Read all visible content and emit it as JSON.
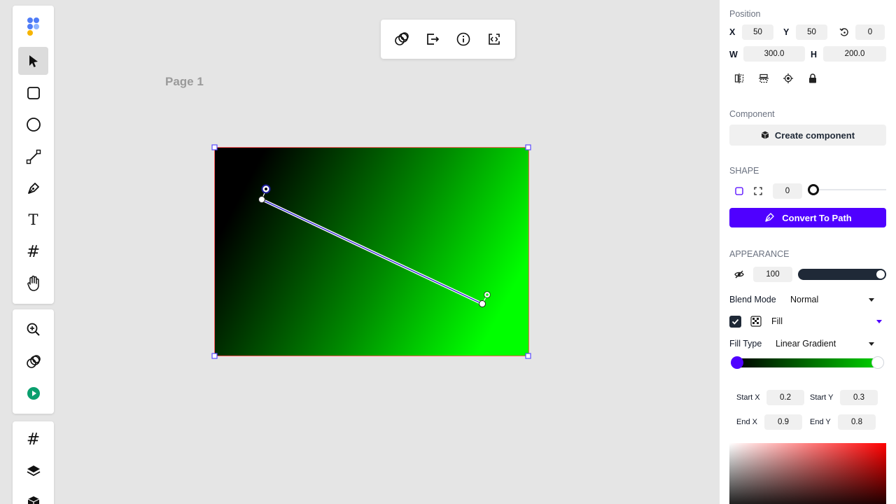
{
  "canvas": {
    "page_label": "Page 1"
  },
  "left_toolbar": {
    "tools": [
      {
        "name": "logo",
        "icon": "logo-icon"
      },
      {
        "name": "select",
        "icon": "cursor-icon",
        "active": true
      },
      {
        "name": "rectangle",
        "icon": "rectangle-icon"
      },
      {
        "name": "ellipse",
        "icon": "ellipse-icon"
      },
      {
        "name": "line",
        "icon": "line-icon"
      },
      {
        "name": "pen",
        "icon": "pen-icon"
      },
      {
        "name": "text",
        "icon": "text-icon",
        "glyph": "T"
      },
      {
        "name": "frame",
        "icon": "frame-icon",
        "glyph": "#"
      },
      {
        "name": "hand",
        "icon": "hand-icon"
      }
    ],
    "secondary": [
      {
        "name": "zoom",
        "icon": "zoom-in-icon"
      },
      {
        "name": "boolean",
        "icon": "boolean-icon"
      },
      {
        "name": "play",
        "icon": "play-icon"
      }
    ],
    "tertiary": [
      {
        "name": "frames",
        "icon": "frame-icon",
        "glyph": "#"
      },
      {
        "name": "layers",
        "icon": "layers-icon"
      },
      {
        "name": "components",
        "icon": "component-icon"
      }
    ]
  },
  "floating_toolbar": {
    "buttons": [
      "boolean-icon",
      "export-icon",
      "info-icon",
      "code-icon"
    ]
  },
  "panel": {
    "position": {
      "title": "Position",
      "x_label": "X",
      "x_value": "50",
      "y_label": "Y",
      "y_value": "50",
      "rotation_value": "0",
      "w_label": "W",
      "w_value": "300.0",
      "h_label": "H",
      "h_value": "200.0"
    },
    "component": {
      "title": "Component",
      "create_label": "Create component"
    },
    "shape": {
      "title": "SHAPE",
      "radius_value": "0",
      "radius_slider_fraction": 0,
      "convert_label": "Convert To Path"
    },
    "appearance": {
      "title": "APPEARANCE",
      "opacity_value": "100",
      "opacity_slider_fraction": 1.0,
      "blend_label": "Blend Mode",
      "blend_value": "Normal",
      "fill_label": "Fill",
      "fill_type_label": "Fill Type",
      "fill_type_value": "Linear Gradient",
      "gradient_start_color": "#000000",
      "gradient_end_color": "#00ff00",
      "start_x_label": "Start X",
      "start_x_value": "0.2",
      "start_y_label": "Start Y",
      "start_y_value": "0.3",
      "end_x_label": "End X",
      "end_x_value": "0.9",
      "end_y_label": "End Y",
      "end_y_value": "0.8"
    },
    "colors": {
      "accent": "#4f00ff",
      "selection": "#ff5c5c"
    }
  }
}
